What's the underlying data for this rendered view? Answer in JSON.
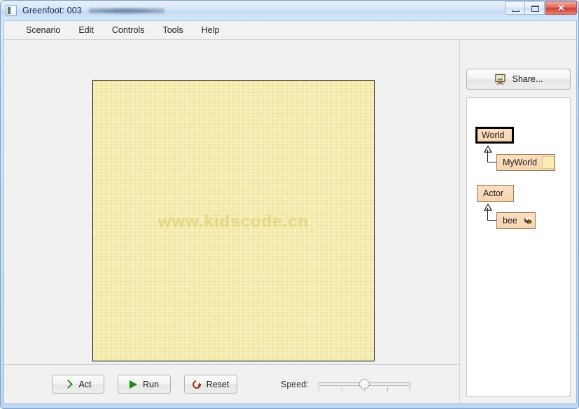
{
  "window": {
    "title": "Greenfoot: 003",
    "icon": "greenfoot-icon",
    "buttons": {
      "minimize": "minimize-icon",
      "maximize": "maximize-icon",
      "close": "✕"
    }
  },
  "menu": {
    "items": [
      {
        "label": "Scenario"
      },
      {
        "label": "Edit"
      },
      {
        "label": "Controls"
      },
      {
        "label": "Tools"
      },
      {
        "label": "Help"
      }
    ]
  },
  "world": {
    "watermark": "www.kidscode.cn",
    "background_color": "#f6eeaf",
    "border_color": "#000000"
  },
  "controls": {
    "act_label": "Act",
    "run_label": "Run",
    "reset_label": "Reset",
    "speed_label": "Speed:",
    "speed_value": 50,
    "act_icon": "chevron-right-icon",
    "run_icon": "play-triangle-icon",
    "reset_icon": "circular-arrow-icon"
  },
  "classpanel": {
    "share_label": "Share...",
    "share_icon": "easel-picture-icon",
    "classes": [
      {
        "name": "World",
        "selected": true,
        "thumb": "none"
      },
      {
        "name": "MyWorld",
        "selected": false,
        "thumb": "yellow-world-thumbnail"
      },
      {
        "name": "Actor",
        "selected": false,
        "thumb": "none"
      },
      {
        "name": "bee",
        "selected": false,
        "thumb": "bee-image-thumbnail"
      }
    ]
  },
  "colors": {
    "class_box_fill": "#f8d9b6",
    "class_box_border": "#9a7a55",
    "accent_green": "#1c8c17",
    "accent_brown": "#8d3a18",
    "window_chrome": "#cfe0f2"
  }
}
